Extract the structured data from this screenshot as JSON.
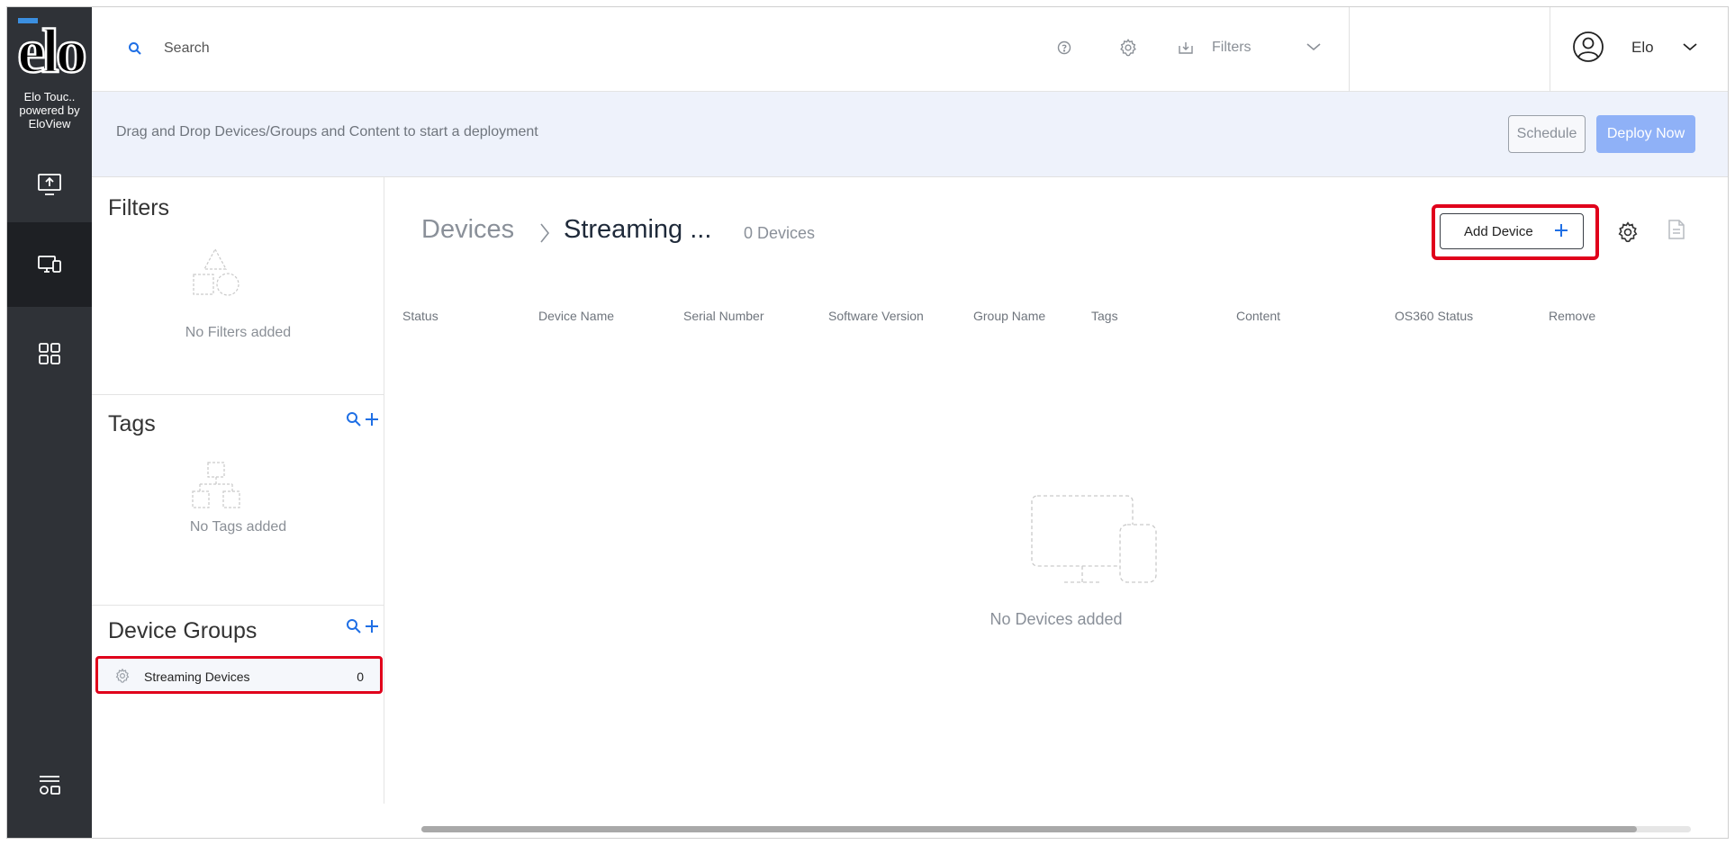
{
  "rail": {
    "brand_line1": "Elo Touc..",
    "brand_line2": "powered by",
    "brand_line3": "EloView",
    "items": [
      {
        "name": "deploy",
        "icon": "upload-screen-icon"
      },
      {
        "name": "devices",
        "icon": "devices-icon",
        "active": true
      },
      {
        "name": "apps",
        "icon": "grid-icon"
      },
      {
        "name": "settings",
        "icon": "layout-settings-icon"
      }
    ]
  },
  "topbar": {
    "search_placeholder": "Search",
    "filters_label": "Filters",
    "user_name": "Elo"
  },
  "banner": {
    "text": "Drag and Drop Devices/Groups and Content to start a deployment",
    "schedule_label": "Schedule",
    "deploy_label": "Deploy Now"
  },
  "leftpanel": {
    "filters": {
      "title": "Filters",
      "empty": "No Filters added"
    },
    "tags": {
      "title": "Tags",
      "empty": "No Tags added"
    },
    "groups": {
      "title": "Device Groups",
      "items": [
        {
          "name": "Streaming Devices",
          "count": "0"
        }
      ]
    }
  },
  "main": {
    "crumb_root": "Devices",
    "crumb_group": "Streaming ...",
    "device_count": "0 Devices",
    "add_label": "Add Device",
    "columns": [
      "Status",
      "Device Name",
      "Serial Number",
      "Software Version",
      "Group Name",
      "Tags",
      "Content",
      "OS360 Status",
      "Remove"
    ],
    "empty": "No Devices added"
  },
  "colors": {
    "rail": "#2f3237",
    "accent": "#1f6fe5",
    "highlight": "#e0001b",
    "deploy": "#8fb1f7"
  }
}
